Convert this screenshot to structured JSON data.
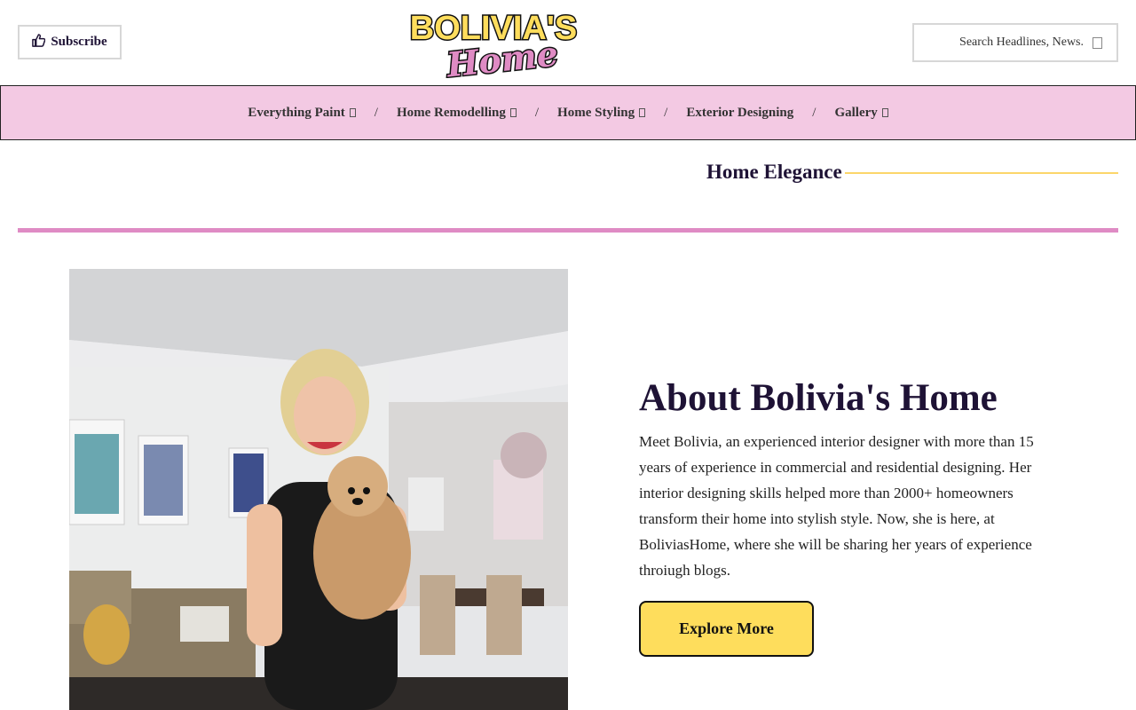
{
  "header": {
    "subscribe_label": "Subscribe",
    "logo_line1": "BOLIVIA'S",
    "logo_line2": "Home",
    "search_placeholder": "Search Headlines, News."
  },
  "nav": {
    "items": [
      {
        "label": "Everything Paint",
        "has_dropdown": true
      },
      {
        "label": "Home Remodelling",
        "has_dropdown": true
      },
      {
        "label": "Home Styling",
        "has_dropdown": true
      },
      {
        "label": "Exterior Designing",
        "has_dropdown": false
      },
      {
        "label": "Gallery",
        "has_dropdown": true
      }
    ],
    "separator": "/"
  },
  "section": {
    "title": "Home Elegance"
  },
  "about": {
    "title": "About Bolivia's Home",
    "text": "Meet Bolivia, an experienced interior designer with more than 15 years of experience in commercial and residential designing. Her interior designing skills helped more than 2000+ homeowners transform their home into stylish style. Now, she is here, at BoliviasHome, where she will be sharing her years of experience throiugh blogs.",
    "button_label": "Explore More"
  },
  "colors": {
    "nav_bg": "#f3c9e3",
    "accent_pink": "#df8bc4",
    "accent_yellow": "#fedd5c",
    "heading": "#1e1235"
  },
  "icons": {
    "subscribe": "thumbs-up-icon",
    "search": "search-icon",
    "dropdown": "chevron-down-icon"
  }
}
